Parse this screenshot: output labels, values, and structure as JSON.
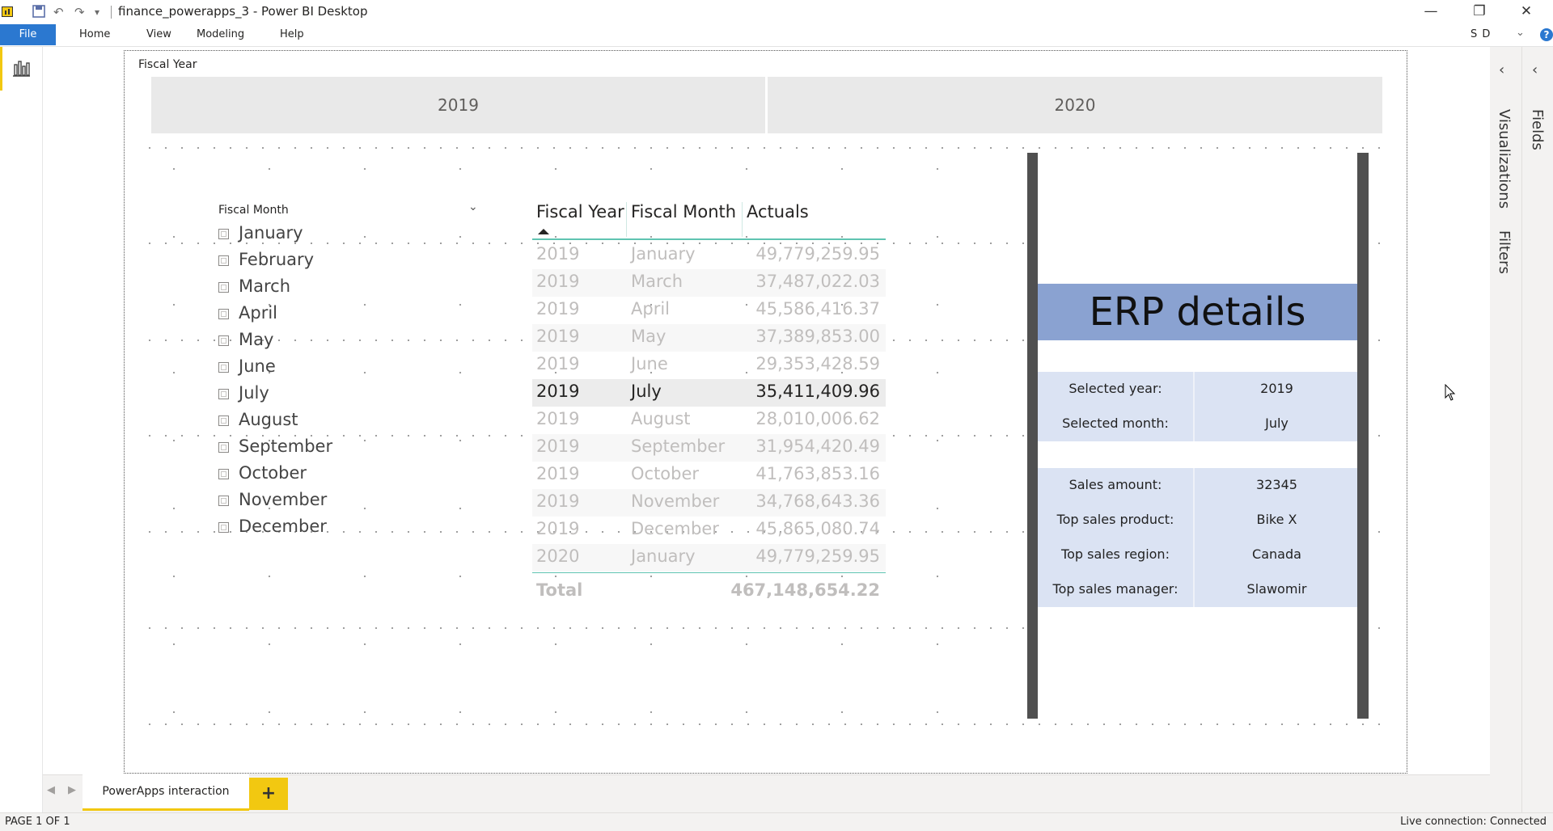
{
  "window": {
    "title": "finance_powerapps_3 - Power BI Desktop",
    "controls": {
      "minimize": "—",
      "restore": "❐",
      "close": "✕"
    }
  },
  "quick_access": {
    "save_icon": "save-icon",
    "undo_icon": "undo-icon",
    "redo_icon": "redo-icon",
    "dropdown": "▾"
  },
  "ribbon": {
    "tabs": [
      "File",
      "Home",
      "View",
      "Modeling",
      "Help"
    ],
    "user": "S D",
    "help": "?"
  },
  "right_panes": {
    "visualizations": "Visualizations",
    "filters": "Filters",
    "fields": "Fields"
  },
  "year_slicer": {
    "title": "Fiscal Year",
    "options": [
      "2019",
      "2020"
    ]
  },
  "month_slicer": {
    "title": "Fiscal Month",
    "options": [
      "January",
      "February",
      "March",
      "April",
      "May",
      "June",
      "July",
      "August",
      "September",
      "October",
      "November",
      "December"
    ]
  },
  "table": {
    "headers": [
      "Fiscal Year",
      "Fiscal Month",
      "Actuals"
    ],
    "rows": [
      [
        "2019",
        "January",
        "49,779,259.95"
      ],
      [
        "2019",
        "March",
        "37,487,022.03"
      ],
      [
        "2019",
        "April",
        "45,586,416.37"
      ],
      [
        "2019",
        "May",
        "37,389,853.00"
      ],
      [
        "2019",
        "June",
        "29,353,428.59"
      ],
      [
        "2019",
        "July",
        "35,411,409.96"
      ],
      [
        "2019",
        "August",
        "28,010,006.62"
      ],
      [
        "2019",
        "September",
        "31,954,420.49"
      ],
      [
        "2019",
        "October",
        "41,763,853.16"
      ],
      [
        "2019",
        "November",
        "34,768,643.36"
      ],
      [
        "2019",
        "December",
        "45,865,080.74"
      ],
      [
        "2020",
        "January",
        "49,779,259.95"
      ]
    ],
    "selected_row": "July",
    "total_label": "Total",
    "total_value": "467,148,654.22"
  },
  "powerapps": {
    "title": "ERP details",
    "selection": [
      {
        "key": "Selected year:",
        "value": "2019"
      },
      {
        "key": "Selected month:",
        "value": "July"
      }
    ],
    "details": [
      {
        "key": "Sales amount:",
        "value": "32345"
      },
      {
        "key": "Top sales product:",
        "value": "Bike X"
      },
      {
        "key": "Top sales region:",
        "value": "Canada"
      },
      {
        "key": "Top sales manager:",
        "value": "Slawomir"
      }
    ]
  },
  "pages": {
    "tabs": [
      "PowerApps interaction"
    ],
    "add": "+"
  },
  "status": {
    "page": "PAGE 1 OF 1",
    "connection": "Live connection: Connected"
  },
  "colors": {
    "accent_yellow": "#f2c811",
    "file_blue": "#2b78d0",
    "erp_header": "#8aa2d1",
    "erp_rows": "#dbe3f3",
    "table_rule": "#5fc4b1"
  }
}
